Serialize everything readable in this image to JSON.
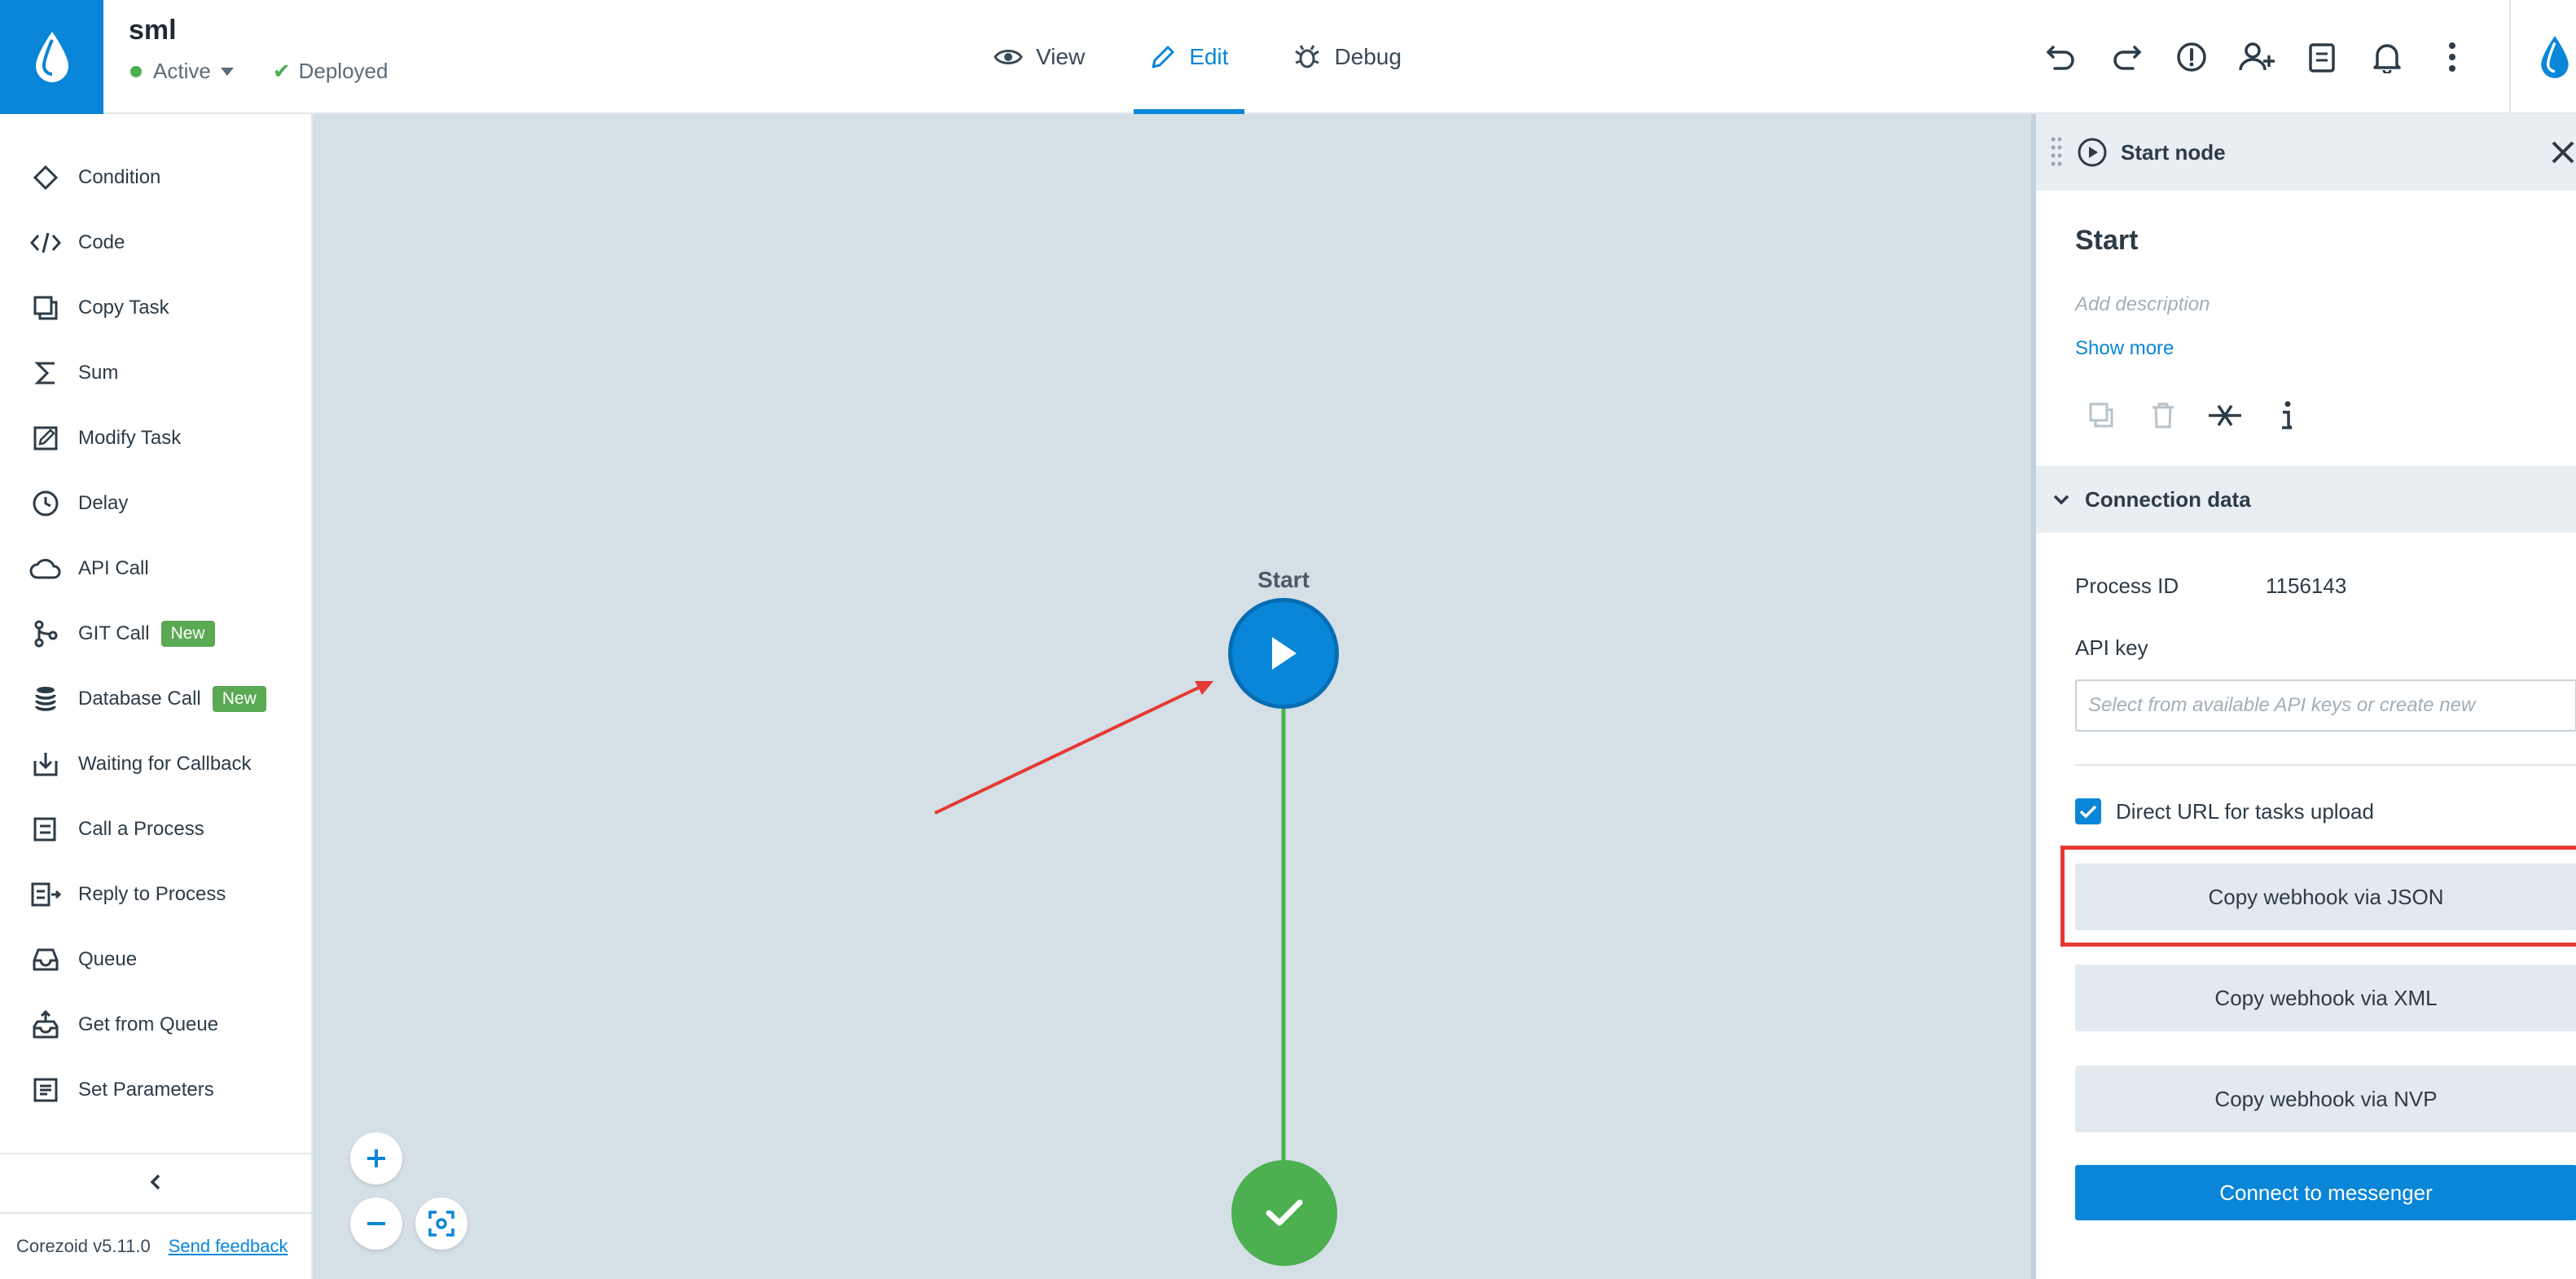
{
  "header": {
    "process_name": "sml",
    "status": "Active",
    "deploy_state": "Deployed",
    "modes": [
      {
        "label": "View",
        "icon": "eye-icon",
        "active": false
      },
      {
        "label": "Edit",
        "icon": "pencil-icon",
        "active": true
      },
      {
        "label": "Debug",
        "icon": "bug-icon",
        "active": false
      }
    ],
    "toolbar_icons": [
      "undo-icon",
      "redo-icon",
      "alert-icon",
      "add-user-icon",
      "clipboard-icon",
      "bell-icon",
      "more-vertical-icon"
    ]
  },
  "sidebar": {
    "items": [
      {
        "label": "Condition",
        "icon": "diamond-icon"
      },
      {
        "label": "Code",
        "icon": "code-icon"
      },
      {
        "label": "Copy Task",
        "icon": "copy-icon"
      },
      {
        "label": "Sum",
        "icon": "sigma-icon"
      },
      {
        "label": "Modify Task",
        "icon": "edit-square-icon"
      },
      {
        "label": "Delay",
        "icon": "clock-icon"
      },
      {
        "label": "API Call",
        "icon": "cloud-icon"
      },
      {
        "label": "GIT Call",
        "icon": "git-icon",
        "badge": "New"
      },
      {
        "label": "Database Call",
        "icon": "database-icon",
        "badge": "New"
      },
      {
        "label": "Waiting for Callback",
        "icon": "download-tray-icon"
      },
      {
        "label": "Call a Process",
        "icon": "call-process-icon"
      },
      {
        "label": "Reply to Process",
        "icon": "reply-process-icon"
      },
      {
        "label": "Queue",
        "icon": "inbox-icon"
      },
      {
        "label": "Get from Queue",
        "icon": "upload-tray-icon"
      },
      {
        "label": "Set Parameters",
        "icon": "list-icon"
      }
    ],
    "version": "Corezoid v5.11.0",
    "feedback": "Send feedback"
  },
  "canvas": {
    "start_label": "Start",
    "colors": {
      "start": "#0a86d8",
      "end": "#4caf50",
      "edge": "#4caf50",
      "background": "#d4dfe6",
      "annotation": "#e53935"
    }
  },
  "panel": {
    "title": "Start node",
    "node_name": "Start",
    "description_placeholder": "Add description",
    "show_more": "Show more",
    "section_title": "Connection data",
    "process_id_label": "Process ID",
    "process_id": "1156143",
    "api_key_label": "API key",
    "api_key_placeholder": "Select from available API keys or create new",
    "direct_url_label": "Direct URL for tasks upload",
    "direct_url_checked": true,
    "btn_json": "Copy webhook via JSON",
    "btn_xml": "Copy webhook via XML",
    "btn_nvp": "Copy webhook via NVP",
    "btn_messenger": "Connect to messenger"
  }
}
